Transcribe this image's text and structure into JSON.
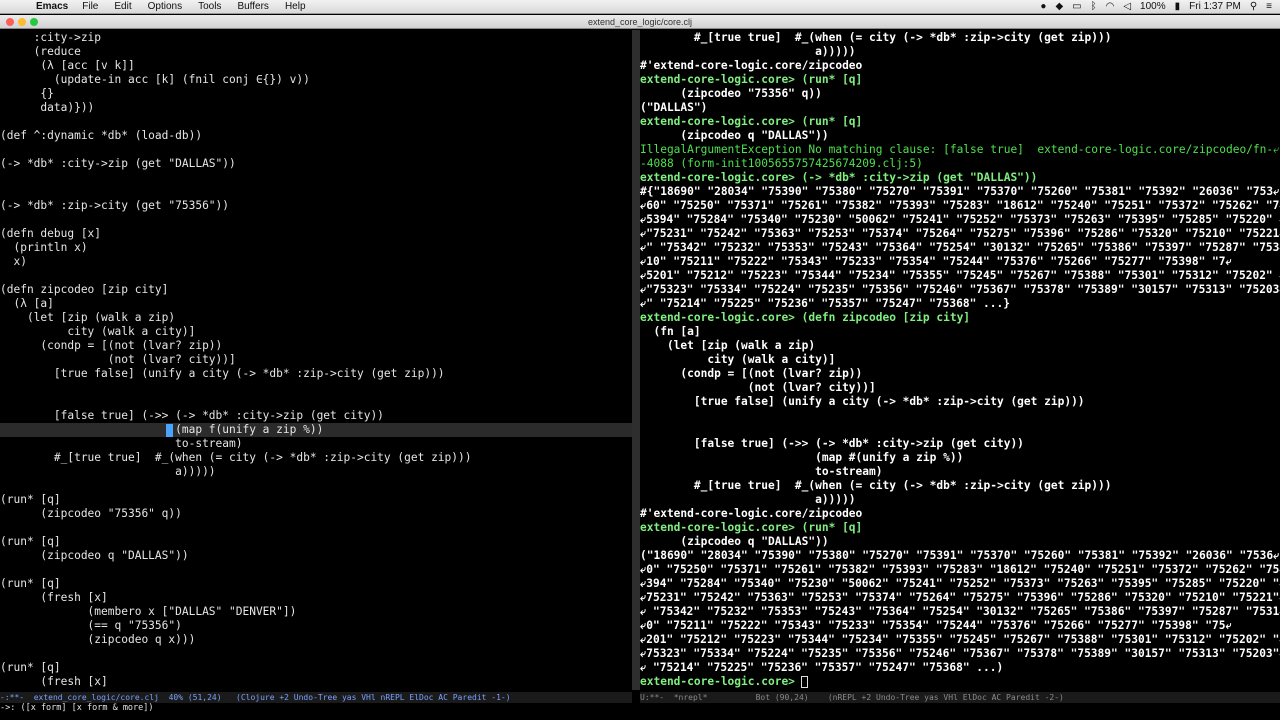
{
  "menubar": {
    "apple": "",
    "app_name": "Emacs",
    "menus": [
      "File",
      "Edit",
      "Options",
      "Tools",
      "Buffers",
      "Help"
    ],
    "battery": "100%",
    "clock": "Fri 1:37 PM"
  },
  "window": {
    "title": "extend_core_logic/core.clj"
  },
  "left_pane": {
    "lines": [
      "     :city->zip",
      "     (reduce",
      "      (λ [acc [v k]]",
      "        (update-in acc [k] (fnil conj ∈{}) v))",
      "      {}",
      "      data)}))",
      "",
      "(def ^:dynamic *db* (load-db))",
      "",
      "(-> *db* :city->zip (get \"DALLAS\"))",
      "",
      "",
      "(-> *db* :zip->city (get \"75356\"))",
      "",
      "(defn debug [x]",
      "  (println x)",
      "  x)",
      "",
      "(defn zipcodeo [zip city]",
      "  (λ [a]",
      "    (let [zip (walk a zip)",
      "          city (walk a city)]",
      "      (condp = [(not (lvar? zip))",
      "                (not (lvar? city))]",
      "        [true false] (unify a city (-> *db* :zip->city (get zip)))",
      "",
      "",
      "        [false true] (->> (-> *db* :city->zip (get city))",
      "                          (map f(unify a zip %))",
      "                          to-stream)",
      "        #_[true true]  #_(when (= city (-> *db* :zip->city (get zip)))",
      "                          a)))))",
      "",
      "(run* [q]",
      "      (zipcodeo \"75356\" q))",
      "",
      "(run* [q]",
      "      (zipcodeo q \"DALLAS\"))",
      "",
      "(run* [q]",
      "      (fresh [x]",
      "             (membero x [\"DALLAS\" \"DENVER\"])",
      "             (== q \"75356\")",
      "             (zipcodeo q x)))",
      "",
      "(run* [q]",
      "      (fresh [x]"
    ]
  },
  "right_pane": {
    "lines": [
      "        #_[true true]  #_(when (= city (-> *db* :zip->city (get zip)))",
      "                          a)))))",
      "#'extend-core-logic.core/zipcodeo",
      "extend-core-logic.core> (run* [q]",
      "      (zipcodeo \"75356\" q))",
      "(\"DALLAS\")",
      "extend-core-logic.core> (run* [q]",
      "      (zipcodeo q \"DALLAS\"))",
      "IllegalArgumentException No matching clause: [false true]  extend-core-logic.core/zipcodeo/fn-⤶",
      "-4088 (form-init1005655757425674209.clj:5)",
      "extend-core-logic.core> (-> *db* :city->zip (get \"DALLAS\"))",
      "#{\"18690\" \"28034\" \"75390\" \"75380\" \"75270\" \"75391\" \"75370\" \"75260\" \"75381\" \"75392\" \"26036\" \"753⤶",
      "⤶60\" \"75250\" \"75371\" \"75261\" \"75382\" \"75393\" \"75283\" \"18612\" \"75240\" \"75251\" \"75372\" \"75262\" \"7⤶",
      "⤶5394\" \"75284\" \"75340\" \"75230\" \"50062\" \"75241\" \"75252\" \"75373\" \"75263\" \"75395\" \"75285\" \"75220\" ⤶",
      "⤶\"75231\" \"75242\" \"75363\" \"75253\" \"75374\" \"75264\" \"75275\" \"75396\" \"75286\" \"75320\" \"75210\" \"75221⤶",
      "⤶\" \"75342\" \"75232\" \"75353\" \"75243\" \"75364\" \"75254\" \"30132\" \"75265\" \"75386\" \"75397\" \"75287\" \"753⤶",
      "⤶10\" \"75211\" \"75222\" \"75343\" \"75233\" \"75354\" \"75244\" \"75376\" \"75266\" \"75277\" \"75398\" \"7⤶",
      "⤶5201\" \"75212\" \"75223\" \"75344\" \"75234\" \"75355\" \"75245\" \"75267\" \"75388\" \"75301\" \"75312\" \"75202\" ⤶",
      "⤶\"75323\" \"75334\" \"75224\" \"75235\" \"75356\" \"75246\" \"75367\" \"75378\" \"75389\" \"30157\" \"75313\" \"75203⤶",
      "⤶\" \"75214\" \"75225\" \"75236\" \"75357\" \"75247\" \"75368\" ...}",
      "extend-core-logic.core> (defn zipcodeo [zip city]",
      "  (fn [a]",
      "    (let [zip (walk a zip)",
      "          city (walk a city)]",
      "      (condp = [(not (lvar? zip))",
      "                (not (lvar? city))]",
      "        [true false] (unify a city (-> *db* :zip->city (get zip)))",
      "",
      "",
      "        [false true] (->> (-> *db* :city->zip (get city))",
      "                          (map #(unify a zip %))",
      "                          to-stream)",
      "        #_[true true]  #_(when (= city (-> *db* :zip->city (get zip)))",
      "                          a)))))",
      "#'extend-core-logic.core/zipcodeo",
      "extend-core-logic.core> (run* [q]",
      "      (zipcodeo q \"DALLAS\"))",
      "(\"18690\" \"28034\" \"75390\" \"75380\" \"75270\" \"75391\" \"75370\" \"75260\" \"75381\" \"75392\" \"26036\" \"7536⤶",
      "⤶0\" \"75250\" \"75371\" \"75261\" \"75382\" \"75393\" \"75283\" \"18612\" \"75240\" \"75251\" \"75372\" \"75262\" \"75⤶",
      "⤶394\" \"75284\" \"75340\" \"75230\" \"50062\" \"75241\" \"75252\" \"75373\" \"75263\" \"75395\" \"75285\" \"75220\" \"⤶",
      "⤶75231\" \"75242\" \"75363\" \"75253\" \"75374\" \"75264\" \"75275\" \"75396\" \"75286\" \"75320\" \"75210\" \"75221\"⤶",
      "⤶ \"75342\" \"75232\" \"75353\" \"75243\" \"75364\" \"75254\" \"30132\" \"75265\" \"75386\" \"75397\" \"75287\" \"7531⤶",
      "⤶0\" \"75211\" \"75222\" \"75343\" \"75233\" \"75354\" \"75244\" \"75376\" \"75266\" \"75277\" \"75398\" \"75⤶",
      "⤶201\" \"75212\" \"75223\" \"75344\" \"75234\" \"75355\" \"75245\" \"75267\" \"75388\" \"75301\" \"75312\" \"75202\" \"⤶",
      "⤶75323\" \"75334\" \"75224\" \"75235\" \"75356\" \"75246\" \"75367\" \"75378\" \"75389\" \"30157\" \"75313\" \"75203\"⤶",
      "⤶ \"75214\" \"75225\" \"75236\" \"75357\" \"75247\" \"75368\" ...)",
      "extend-core-logic.core> "
    ]
  },
  "modeline_left": "-:**-  extend_core_logic/core.clj  40% (51,24)   (Clojure +2 Undo-Tree yas VHl nREPL ElDoc AC Paredit -1-)",
  "modeline_right": "U:**-  *nrepl*          Bot (90,24)    (nREPL +2 Undo-Tree yas VHl ElDoc AC Paredit -2-)",
  "minibuffer": "->: ([x form] [x form & more])"
}
